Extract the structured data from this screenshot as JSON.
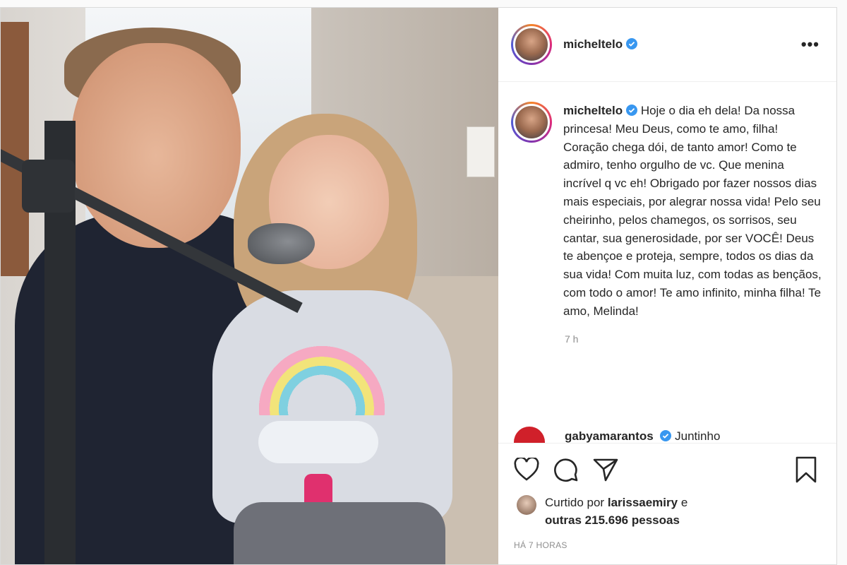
{
  "post": {
    "username": "micheltelo",
    "caption": "Hoje o dia eh dela! Da nossa princesa! Meu Deus, como te amo, filha! Coração chega dói, de tanto amor! Como te admiro, tenho orgulho de vc. Que menina incrível q vc eh! Obrigado por fazer nossos dias mais especiais, por alegrar nossa vida! Pelo seu cheirinho, pelos chamegos, os sorrisos, seu cantar, sua generosidade, por ser VOCÊ! Deus te abençoe e proteja, sempre, todos os dias da sua vida! Com muita luz, com todas as bençãos, com todo o amor! Te amo infinito, minha filha! Te amo, Melinda!",
    "caption_time": "7 h",
    "more_icon": "more-horizontal-icon",
    "verified_icon": "verified-badge-icon"
  },
  "comment": {
    "username": "gabyamarantos",
    "text": "Juntinho"
  },
  "likes": {
    "prefix": "Curtido por",
    "user": "larissaemiry",
    "conjunction": "e",
    "others": "outras 215.696 pessoas"
  },
  "timestamp": "HÁ 7 HORAS",
  "icons": [
    "heart-icon",
    "comment-icon",
    "share-icon",
    "bookmark-icon"
  ],
  "colors": {
    "verified": "#3897f0",
    "text": "#262626",
    "muted": "#8e8e8e"
  }
}
